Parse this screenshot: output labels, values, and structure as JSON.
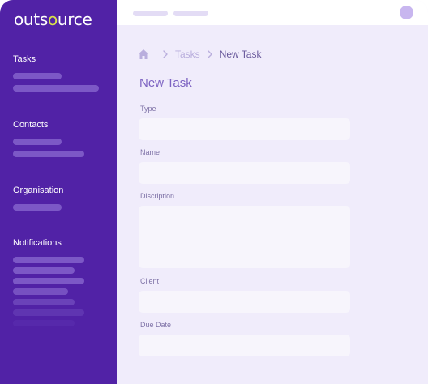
{
  "brand": {
    "prefix": "outs",
    "accent": "o",
    "suffix": "urce"
  },
  "sidebar": {
    "sections": [
      {
        "title": "Tasks"
      },
      {
        "title": "Contacts"
      },
      {
        "title": "Organisation"
      },
      {
        "title": "Notifications"
      }
    ]
  },
  "breadcrumb": {
    "items": [
      "Tasks",
      "New Task"
    ]
  },
  "form": {
    "title": "New Task",
    "fields": {
      "type": {
        "label": "Type",
        "value": ""
      },
      "name": {
        "label": "Name",
        "value": ""
      },
      "description": {
        "label": "Discription",
        "value": ""
      },
      "client": {
        "label": "Client",
        "value": ""
      },
      "due_date": {
        "label": "Due Date",
        "value": ""
      }
    }
  },
  "colors": {
    "sidebar": "#5122a6",
    "background": "#f0ecfb",
    "accent": "#d9e24a",
    "title": "#7d63c2"
  }
}
